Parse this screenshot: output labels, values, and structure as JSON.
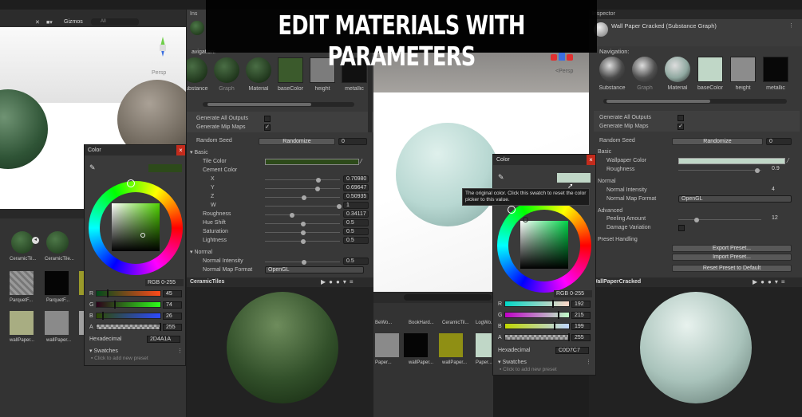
{
  "banner": {
    "title": "EDIT MATERIALS WITH PARAMETERS"
  },
  "scene": {
    "gizmos": "Gizmos",
    "search": "All",
    "persp": "Persp"
  },
  "left_inspector": {
    "thumbs": [
      {
        "label": "Substance",
        "color": "#2a4226"
      },
      {
        "label": "Graph",
        "color": "#2f3f2c"
      },
      {
        "label": "Material",
        "color": "#243822"
      },
      {
        "label": "baseColor",
        "color": "#3b5a2c"
      },
      {
        "label": "height",
        "color": "#7c7c7c"
      },
      {
        "label": "metallic",
        "color": "#111111"
      }
    ],
    "navigation": "avigation:",
    "gen_outputs": "Generate All Outputs",
    "gen_mips": "Generate Mip Maps",
    "random_seed": "Random Seed",
    "randomize": "Randomize",
    "seed_value": "0",
    "basic": "Basic",
    "tile_color": "Tile Color",
    "cement_color": "Cement Color",
    "vec": [
      {
        "label": "X",
        "value": "0.70980"
      },
      {
        "label": "Y",
        "value": "0.69647"
      },
      {
        "label": "Z",
        "value": "0.50935"
      },
      {
        "label": "W",
        "value": "1"
      }
    ],
    "sliders": [
      {
        "label": "Roughness",
        "value": "0.34117"
      },
      {
        "label": "Hue Shift",
        "value": "0.5"
      },
      {
        "label": "Saturation",
        "value": "0.5"
      },
      {
        "label": "Lightness",
        "value": "0.5"
      }
    ],
    "normal": "Normal",
    "normal_intensity": "Normal Intensity",
    "normal_intensity_value": "0.5",
    "normal_map_format": "Normal Map Format",
    "normal_map_format_value": "OpenGL"
  },
  "left_project": {
    "items_row1": [
      "CeramicTil...",
      "CeramicTile..."
    ],
    "items_row2": [
      "ParquetF...",
      "ParquetF..."
    ],
    "items_row3": [
      "wallPaper...",
      "wallPaper..."
    ]
  },
  "left_preview": {
    "name": "CeramicTiles"
  },
  "left_color": {
    "title": "Color",
    "mode": "RGB 0-255",
    "channels": [
      {
        "label": "R",
        "value": "45"
      },
      {
        "label": "G",
        "value": "74"
      },
      {
        "label": "B",
        "value": "26"
      },
      {
        "label": "A",
        "value": "255"
      }
    ],
    "hex_label": "Hexadecimal",
    "hex": "2D4A1A",
    "swatches": "Swatches",
    "add_preset": "Click to add new preset",
    "swatch": "#2d4a1a"
  },
  "right_inspector": {
    "tab": "Inspector",
    "title": "Wall Paper Cracked (Substance Graph)",
    "navigation": "Navigation:",
    "thumbs": [
      {
        "label": "Substance",
        "color": "#4a4a4a"
      },
      {
        "label": "Graph",
        "color": "#505050"
      },
      {
        "label": "Material",
        "color": "#8fa8a0"
      },
      {
        "label": "baseColor",
        "color": "#c0d7c7"
      },
      {
        "label": "height",
        "color": "#8c8c8c"
      },
      {
        "label": "metallic",
        "color": "#080808"
      }
    ],
    "gen_outputs": "Generate All Outputs",
    "gen_mips": "Generate Mip Maps",
    "random_seed": "Random Seed",
    "randomize": "Randomize",
    "seed_value": "0",
    "basic": "Basic",
    "wallpaper_color": "Wallpaper Color",
    "roughness": "Roughness",
    "roughness_value": "0.9",
    "normal": "Normal",
    "normal_intensity": "Normal Intensity",
    "normal_intensity_value": "4",
    "normal_map_format": "Normal Map Format",
    "normal_map_format_value": "OpenGL",
    "advanced": "Advanced",
    "peeling": "Peeling Amount",
    "peeling_value": "12",
    "damage": "Damage Variation",
    "preset": "Preset Handling",
    "export": "Export Preset...",
    "import": "Import Preset...",
    "reset": "Reset Preset to Default"
  },
  "right_color": {
    "title": "Color",
    "mode": "RGB 0-255",
    "tooltip": "The original color. Click this swatch to reset the color picker to this value.",
    "channels": [
      {
        "label": "R",
        "value": "192"
      },
      {
        "label": "G",
        "value": "215"
      },
      {
        "label": "B",
        "value": "199"
      },
      {
        "label": "A",
        "value": "255"
      }
    ],
    "hex_label": "Hexadecimal",
    "hex": "C0D7C7",
    "swatches": "Swatches",
    "add_preset": "Click to add new preset",
    "swatch": "#c0d7c7"
  },
  "mid_project": {
    "items_row1": [
      "BeWo...",
      "BookHard...",
      "CeramicTil...",
      "LogWo..."
    ],
    "items_row3": [
      "Paper...",
      "wallPaper...",
      "wallPaper...",
      "Paper..."
    ]
  },
  "right_preview": {
    "name": "WallPaperCracked"
  }
}
